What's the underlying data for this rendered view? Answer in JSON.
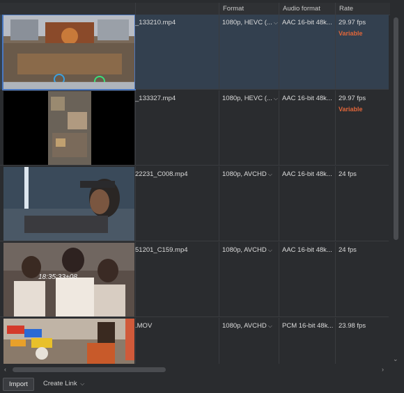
{
  "header": {
    "columns": [
      "Format",
      "Audio format",
      "Rate"
    ]
  },
  "rows": [
    {
      "name": "_133210.mp4",
      "format": "1080p, HEVC (...",
      "audio": "AAC 16-bit 48k...",
      "rate": "29.97 fps",
      "rate_note": "Variable",
      "selected": true
    },
    {
      "name": "_133327.mp4",
      "format": "1080p, HEVC (...",
      "audio": "AAC 16-bit 48k...",
      "rate": "29.97 fps",
      "rate_note": "Variable",
      "selected": false
    },
    {
      "name": "22231_C008.mp4",
      "format": "1080p, AVCHD",
      "audio": "AAC 16-bit 48k...",
      "rate": "24 fps",
      "rate_note": "",
      "selected": false
    },
    {
      "name": "51201_C159.mp4",
      "format": "1080p, AVCHD",
      "audio": "AAC 16-bit 48k...",
      "rate": "24 fps",
      "rate_note": "",
      "selected": false,
      "overlay": "18:35:33+08"
    },
    {
      "name": ".MOV",
      "format": "1080p, AVCHD",
      "audio": "PCM 16-bit 48k...",
      "rate": "23.98 fps",
      "rate_note": "",
      "selected": false
    }
  ],
  "footer": {
    "import_label": "Import",
    "create_link_label": "Create Link"
  },
  "colors": {
    "variable": "#e0663a",
    "selection_bg": "#33404f",
    "selection_outline": "#4a78c2"
  }
}
